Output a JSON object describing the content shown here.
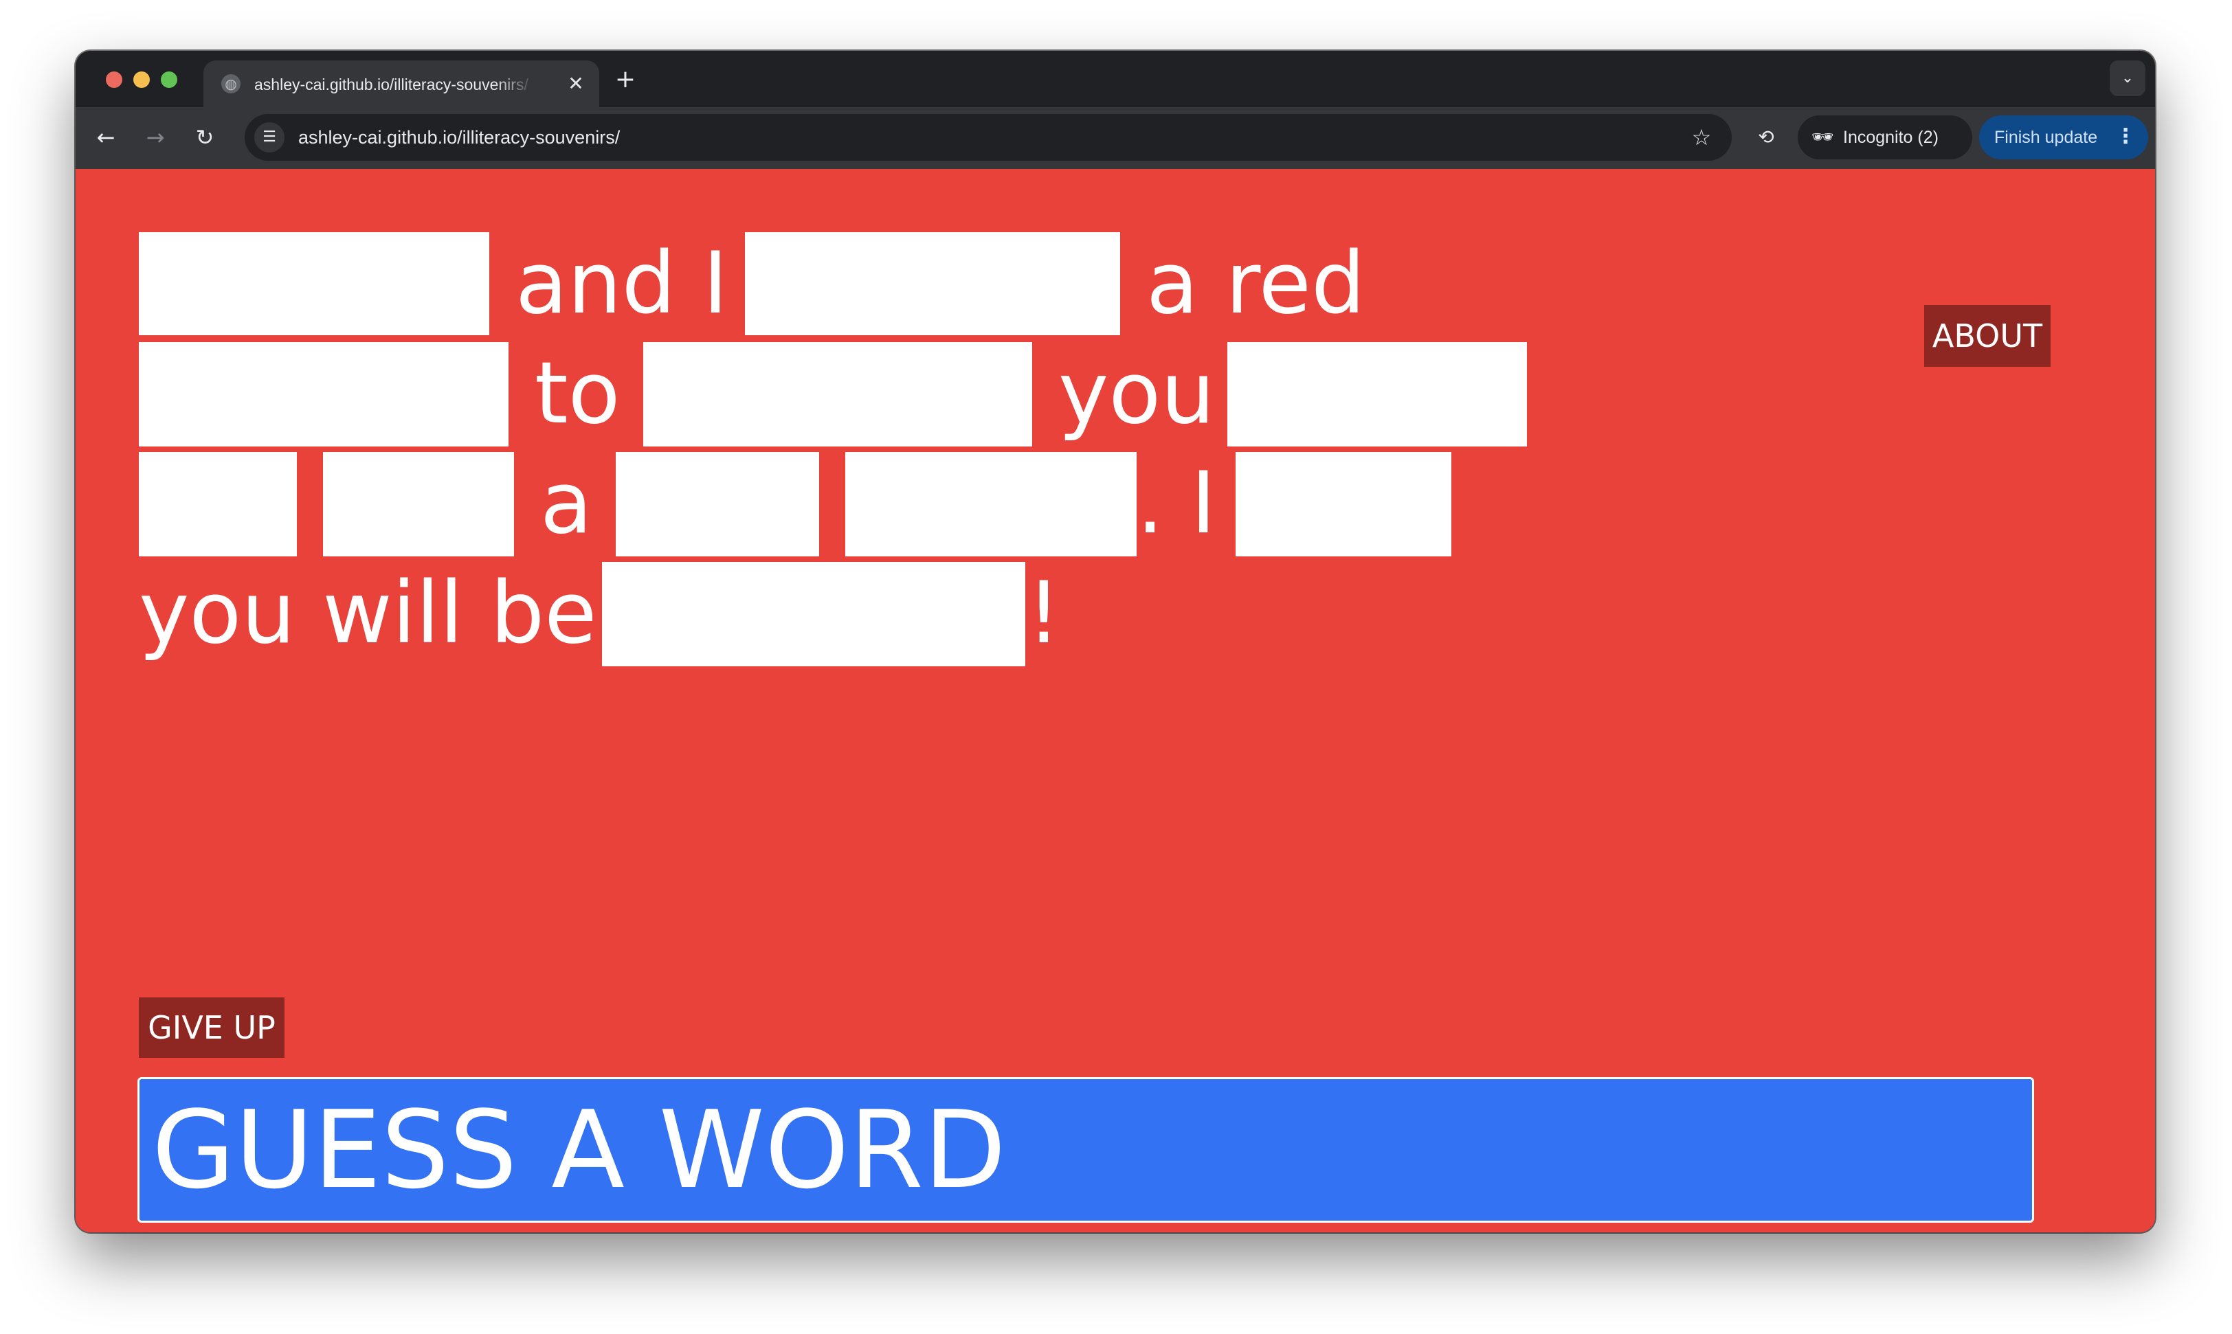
{
  "browser": {
    "tab_title": "ashley-cai.github.io/illiteracy-souvenirs/",
    "tab_close": "✕",
    "new_tab": "+",
    "tab_search": "⌄",
    "back": "←",
    "forward": "→",
    "reload": "↻",
    "url": "ashley-cai.github.io/illiteracy-souvenirs/",
    "bookmark": "☆",
    "incognito_label": "Incognito (2)",
    "finish_update_label": "Finish update",
    "menu": "⋮"
  },
  "game": {
    "words": [
      "and I",
      "a red",
      "to",
      "you",
      "a",
      ". I",
      "you will be",
      "!"
    ],
    "about_label": "ABOUT",
    "give_up_label": "GIVE UP",
    "guess_placeholder": "GUESS A WORD"
  },
  "colors": {
    "page_background": "#e9423a",
    "button_background": "#8e2622",
    "input_background": "#3472f4",
    "blank_fill": "#ffffff"
  },
  "icons": {
    "site_info": "tune-icon",
    "incognito": "incognito-icon",
    "extension": "extension-icon"
  }
}
